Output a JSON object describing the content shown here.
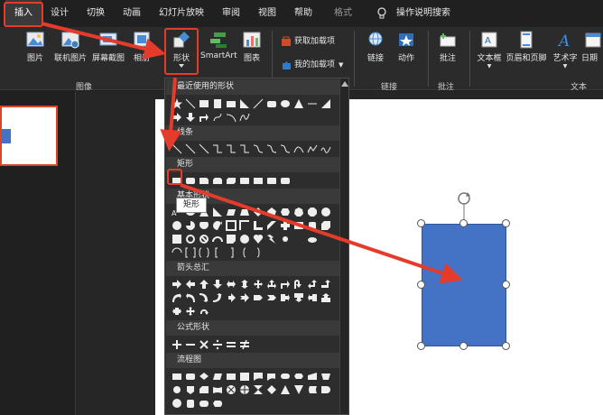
{
  "menu": {
    "tabs": [
      {
        "label": "插入"
      },
      {
        "label": "设计"
      },
      {
        "label": "切换"
      },
      {
        "label": "动画"
      },
      {
        "label": "幻灯片放映"
      },
      {
        "label": "审阅"
      },
      {
        "label": "视图"
      },
      {
        "label": "帮助"
      },
      {
        "label": "格式"
      }
    ],
    "search_label": "操作说明搜索"
  },
  "ribbon": {
    "picture": "图片",
    "online_picture": "联机图片",
    "screenshot": "屏幕截图",
    "album": "相册",
    "shapes": "形状",
    "smartart": "SmartArt",
    "chart": "图表",
    "get_addins": "获取加载项",
    "my_addins": "我的加载项",
    "link": "链接",
    "action": "动作",
    "comment": "批注",
    "textbox": "文本框",
    "header_footer": "页眉和页脚",
    "wordart": "艺术字",
    "datetime": "日期",
    "groups": {
      "images": "图像",
      "links": "链接",
      "comments": "批注",
      "text": "文本"
    }
  },
  "gallery": {
    "sections": [
      {
        "title": "最近使用的形状"
      },
      {
        "title": "线条"
      },
      {
        "title": "矩形"
      },
      {
        "title": "基本形状"
      },
      {
        "title": "箭头总汇"
      },
      {
        "title": "公式形状"
      },
      {
        "title": "流程图"
      }
    ],
    "tooltip": "矩形"
  },
  "colors": {
    "accent_red": "#e53b2b",
    "shape_blue": "#4472c4"
  }
}
